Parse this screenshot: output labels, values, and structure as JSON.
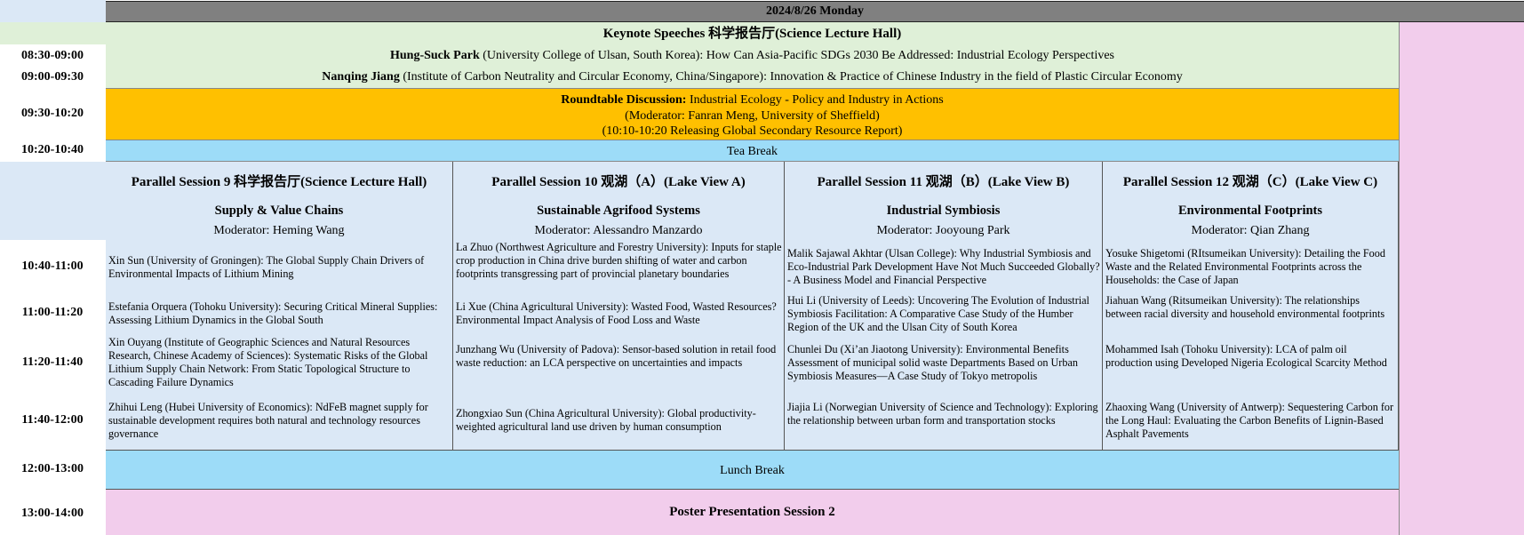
{
  "date": "2024/8/26 Monday",
  "keynote": {
    "title": "Keynote Speeches 科学报告厅(Science Lecture Hall)",
    "talks": [
      {
        "time": "08:30-09:00",
        "speaker": "Hung-Suck Park",
        "detail": " (University College of Ulsan, South Korea): How Can Asia-Pacific SDGs 2030 Be Addressed: Industrial Ecology Perspectives"
      },
      {
        "time": "09:00-09:30",
        "speaker": "Nanqing Jiang",
        "detail": " (Institute of Carbon Neutrality and Circular Economy, China/Singapore): Innovation & Practice of Chinese Industry in the field of Plastic Circular Economy"
      }
    ]
  },
  "roundtable": {
    "time": "09:30-10:20",
    "label": "Roundtable Discussion:",
    "topic": " Industrial Ecology - Policy and Industry in Actions",
    "moderator": "(Moderator: Fanran Meng, University of Sheffield)",
    "note": "(10:10-10:20 Releasing Global Secondary Resource Report)"
  },
  "tea_break": {
    "time": "10:20-10:40",
    "label": "Tea Break"
  },
  "slot_times": [
    "10:40-11:00",
    "11:00-11:20",
    "11:20-11:40",
    "11:40-12:00"
  ],
  "sessions": [
    {
      "title": "Parallel Session 9 科学报告厅(Science Lecture Hall)",
      "theme": "Supply & Value Chains",
      "moderator": "Moderator: Heming Wang",
      "talks": [
        "Xin Sun (University of Groningen): The Global Supply Chain Drivers of Environmental Impacts of Lithium Mining",
        "Estefania Orquera (Tohoku University): Securing Critical Mineral Supplies: Assessing Lithium Dynamics in the Global South",
        "Xin Ouyang (Institute of Geographic Sciences and Natural Resources Research, Chinese Academy of Sciences): Systematic Risks of the Global Lithium Supply Chain Network: From Static Topological Structure to Cascading Failure Dynamics",
        "Zhihui Leng (Hubei University of Economics): NdFeB magnet supply for sustainable development requires both natural and technology resources governance"
      ]
    },
    {
      "title": "Parallel Session 10 观湖（A）(Lake View A)",
      "theme": "Sustainable Agrifood Systems",
      "moderator": "Moderator: Alessandro Manzardo",
      "talks": [
        "La Zhuo (Northwest Agriculture and Forestry University): Inputs for staple crop production in China drive burden shifting of water and carbon footprints transgressing part of provincial planetary boundaries",
        "Li Xue (China Agricultural University): Wasted Food, Wasted Resources? Environmental Impact Analysis of Food Loss and Waste",
        "Junzhang Wu (University of Padova): Sensor-based solution in retail food waste reduction: an LCA perspective on uncertainties and impacts",
        "Zhongxiao Sun (China Agricultural University): Global productivity-weighted agricultural land use driven by human consumption"
      ]
    },
    {
      "title": "Parallel Session 11 观湖（B）(Lake View B)",
      "theme": "Industrial Symbiosis",
      "moderator": "Moderator: Jooyoung Park",
      "talks": [
        "Malik Sajawal Akhtar (Ulsan College): Why Industrial Symbiosis and Eco-Industrial Park Development Have Not Much Succeeded Globally? - A Business Model and Financial Perspective",
        "Hui Li (University of Leeds): Uncovering The Evolution of Industrial Symbiosis Facilitation: A Comparative Case Study of the Humber Region of the UK and the Ulsan City of South Korea",
        "Chunlei Du (Xi’an Jiaotong University): Environmental Benefits Assessment of municipal solid waste Departments Based on Urban Symbiosis Measures—A Case Study of Tokyo metropolis",
        "Jiajia Li (Norwegian University of Science and Technology): Exploring the relationship between urban form and transportation stocks"
      ]
    },
    {
      "title": "Parallel Session 12 观湖（C）(Lake View C)",
      "theme": "Environmental Footprints",
      "moderator": "Moderator: Qian Zhang",
      "talks": [
        "Yosuke Shigetomi (RItsumeikan University): Detailing the Food Waste and the Related Environmental Footprints across the Households: the Case of Japan",
        "Jiahuan Wang (Ritsumeikan University): The relationships between racial diversity and household environmental footprints",
        "Mohammed Isah (Tohoku University): LCA of palm oil production using Developed Nigeria Ecological Scarcity Method",
        "Zhaoxing Wang (University of Antwerp): Sequestering Carbon for the Long Haul: Evaluating the Carbon Benefits of Lignin-Based Asphalt Pavements"
      ]
    }
  ],
  "lunch": {
    "time": "12:00-13:00",
    "label": "Lunch Break"
  },
  "poster": {
    "time": "13:00-14:00",
    "label": "Poster Presentation Session 2"
  },
  "colors": {
    "header": "#808080",
    "keynote": "#dff0d8",
    "roundtable": "#ffc000",
    "break": "#9ddcf8",
    "session": "#dbe8f6",
    "poster": "#f2cdec"
  }
}
